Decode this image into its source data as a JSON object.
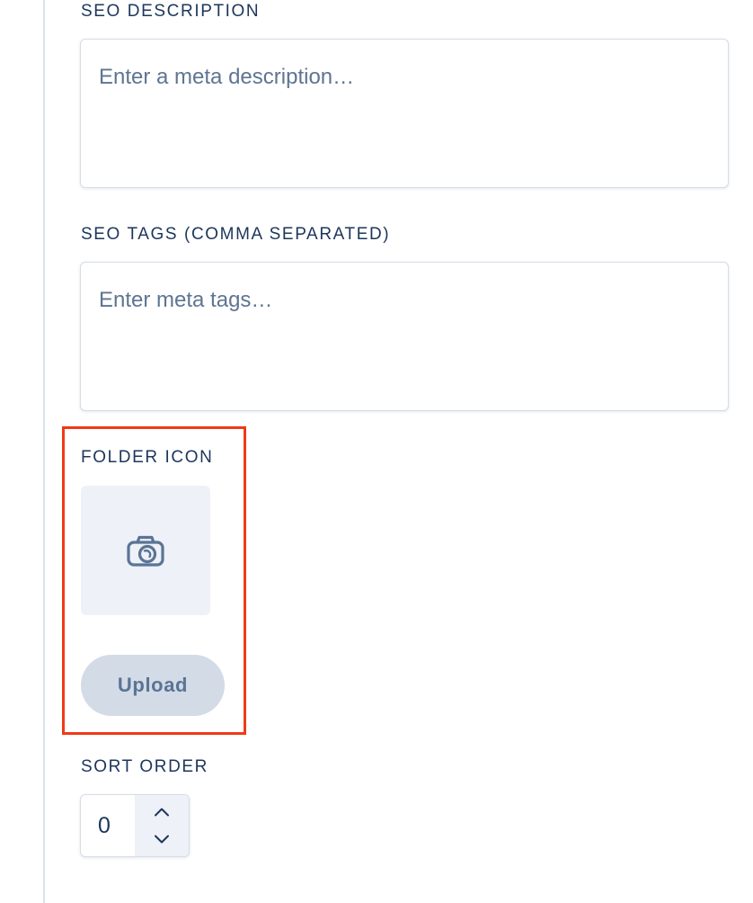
{
  "form": {
    "seo_description": {
      "label": "SEO DESCRIPTION",
      "placeholder": "Enter a meta description…",
      "value": ""
    },
    "seo_tags": {
      "label": "SEO TAGS (COMMA SEPARATED)",
      "placeholder": "Enter meta tags…",
      "value": ""
    },
    "folder_icon": {
      "label": "FOLDER ICON",
      "preview_icon": "camera-icon",
      "upload_label": "Upload"
    },
    "sort_order": {
      "label": "SORT ORDER",
      "value": "0",
      "increment_icon": "chevron-up-icon",
      "decrement_icon": "chevron-down-icon"
    }
  },
  "colors": {
    "label_text": "#1c365b",
    "placeholder_text": "#5e7592",
    "highlight_border": "#f03a17",
    "upload_button_bg": "#d3dbe7",
    "preview_bg": "#eef1f7"
  }
}
